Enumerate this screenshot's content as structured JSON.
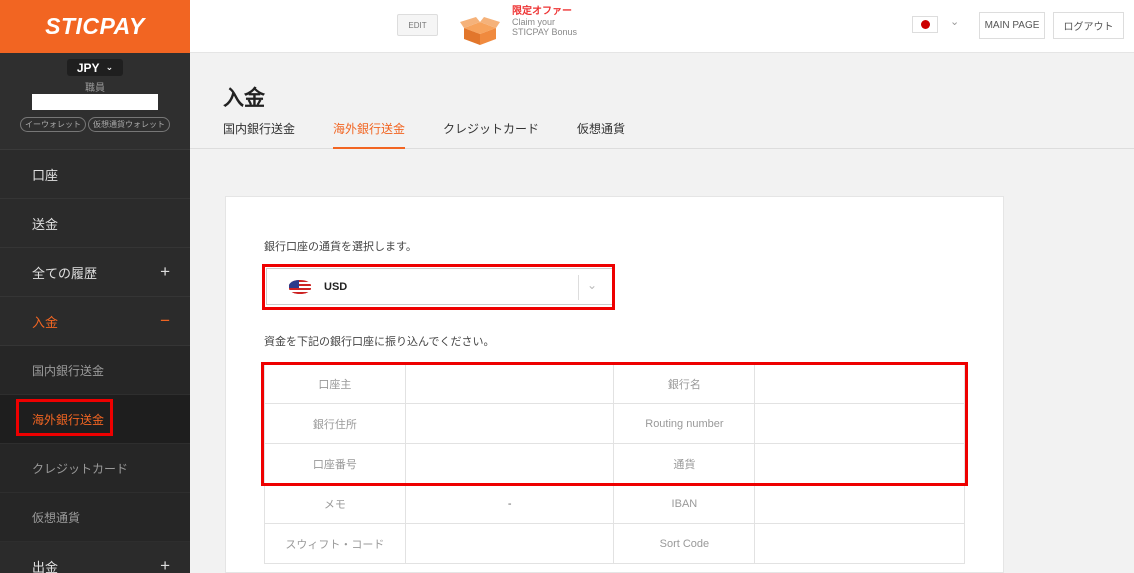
{
  "brand": {
    "logo": "STICPAY"
  },
  "user": {
    "currency": "JPY",
    "name": "職員",
    "wallets": [
      "イーウォレット",
      "仮想通貨ウォレット"
    ]
  },
  "sidebar": {
    "items": [
      {
        "label": "口座",
        "sign": ""
      },
      {
        "label": "送金",
        "sign": ""
      },
      {
        "label": "全ての履歴",
        "sign": "+"
      },
      {
        "label": "入金",
        "sign": "−"
      }
    ],
    "sub_items": [
      {
        "label": "国内銀行送金"
      },
      {
        "label": "海外銀行送金"
      },
      {
        "label": "クレジットカード"
      },
      {
        "label": "仮想通貨"
      }
    ],
    "bottom_item": {
      "label": "出金",
      "sign": "+"
    }
  },
  "topbar": {
    "edit_label": "EDIT",
    "promo_title": "限定オファー",
    "promo_line1": "Claim your",
    "promo_line2": "STICPAY Bonus",
    "main_page_label": "MAIN PAGE",
    "logout_label": "ログアウト"
  },
  "page": {
    "title": "入金",
    "tabs": [
      "国内銀行送金",
      "海外銀行送金",
      "クレジットカード",
      "仮想通貨"
    ],
    "active_tab": 1
  },
  "form": {
    "select_label": "銀行口座の通貨を選択します。",
    "selected_currency": "USD",
    "instruction": "資金を下記の銀行口座に振り込んでください。"
  },
  "bank_table": {
    "rows": [
      {
        "k1": "口座主",
        "v1": "",
        "k2": "銀行名",
        "v2": ""
      },
      {
        "k1": "銀行住所",
        "v1": "",
        "k2": "Routing number",
        "v2": ""
      },
      {
        "k1": "口座番号",
        "v1": "",
        "k2": "通貨",
        "v2": ""
      },
      {
        "k1": "メモ",
        "v1": "-",
        "k2": "IBAN",
        "v2": ""
      },
      {
        "k1": "スウィフト・コード",
        "v1": "",
        "k2": "Sort Code",
        "v2": ""
      }
    ]
  },
  "colors": {
    "accent": "#f26522",
    "highlight": "#ee0000",
    "sidebar_bg": "#2b2b2b"
  }
}
